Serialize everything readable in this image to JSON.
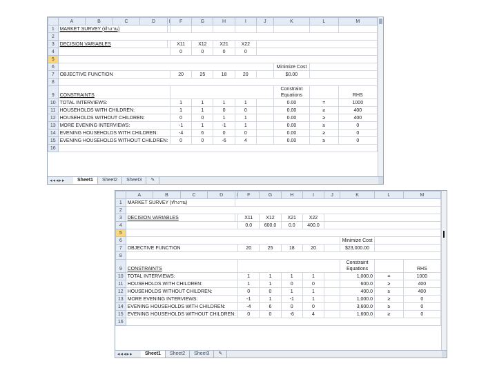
{
  "columns": [
    "A",
    "B",
    "C",
    "D",
    "E",
    "F",
    "G",
    "H",
    "I",
    "J",
    "K",
    "L",
    "M"
  ],
  "sheet_tabs": [
    "Sheet1",
    "Sheet2",
    "Sheet3"
  ],
  "nav_glyphs": "◂◂◂▸▸",
  "spreadsheet1": {
    "title": "MARKET SURVEY (ทำงาน)",
    "decision_label": "DECISION VARIABLES",
    "vars": [
      "X11",
      "X12",
      "X21",
      "X22"
    ],
    "var_values": [
      "0",
      "0",
      "0",
      "0"
    ],
    "minimize_cost_label": "Minimize Cost",
    "objective_label": "OBJECTIVE FUNCTION",
    "objective_coeffs": [
      "20",
      "25",
      "18",
      "20"
    ],
    "cost_value": "$0.00",
    "constraints_label": "CONSTRAINTS",
    "constraint_equations_label": "Constraint Equations",
    "rhs_label": "RHS",
    "constraints": [
      {
        "name": "TOTAL INTERVIEWS:",
        "c": [
          "1",
          "1",
          "1",
          "1"
        ],
        "eq": "0.00",
        "op": "=",
        "rhs": "1000"
      },
      {
        "name": "HOUSEHOLDS WITH CHILDREN:",
        "c": [
          "1",
          "1",
          "0",
          "0"
        ],
        "eq": "0.00",
        "op": "≥",
        "rhs": "400"
      },
      {
        "name": "HOUSEHOLDS WITHOUT CHILDREN:",
        "c": [
          "0",
          "0",
          "1",
          "1"
        ],
        "eq": "0.00",
        "op": "≥",
        "rhs": "400"
      },
      {
        "name": "MORE EVENING INTERVIEWS:",
        "c": [
          "-1",
          "1",
          "-1",
          "1"
        ],
        "eq": "0.00",
        "op": "≥",
        "rhs": "0"
      },
      {
        "name": "EVENING HOUSEHOLDS WITH CHILDREN:",
        "c": [
          "-4",
          "6",
          "0",
          "0"
        ],
        "eq": "0.00",
        "op": "≥",
        "rhs": "0"
      },
      {
        "name": "EVENING HOUSEHOLDS WITHOUT CHILDREN:",
        "c": [
          "0",
          "0",
          "-6",
          "4"
        ],
        "eq": "0.00",
        "op": "≥",
        "rhs": "0"
      }
    ]
  },
  "spreadsheet2": {
    "title": "MARKET SURVEY (ทำงาน)",
    "decision_label": "DECISION VARIABLES",
    "vars": [
      "X11",
      "X12",
      "X21",
      "X22"
    ],
    "var_values": [
      "0.0",
      "600.0",
      "0.0",
      "400.0"
    ],
    "minimize_cost_label": "Minimize Cost",
    "objective_label": "OBJECTIVE FUNCTION",
    "objective_coeffs": [
      "20",
      "25",
      "18",
      "20"
    ],
    "cost_value": "$23,000.00",
    "constraints_label": "CONSTRAINTS",
    "constraint_equations_label": "Constraint Equations",
    "rhs_label": "RHS",
    "constraints": [
      {
        "name": "TOTAL INTERVIEWS:",
        "c": [
          "1",
          "1",
          "1",
          "1"
        ],
        "eq": "1,000.0",
        "op": "=",
        "rhs": "1000"
      },
      {
        "name": "HOUSEHOLDS WITH CHILDREN:",
        "c": [
          "1",
          "1",
          "0",
          "0"
        ],
        "eq": "600.0",
        "op": "≥",
        "rhs": "400"
      },
      {
        "name": "HOUSEHOLDS WITHOUT CHILDREN:",
        "c": [
          "0",
          "0",
          "1",
          "1"
        ],
        "eq": "400.0",
        "op": "≥",
        "rhs": "400"
      },
      {
        "name": "MORE EVENING INTERVIEWS:",
        "c": [
          "-1",
          "1",
          "-1",
          "1"
        ],
        "eq": "1,000.0",
        "op": "≥",
        "rhs": "0"
      },
      {
        "name": "EVENING HOUSEHOLDS WITH CHILDREN:",
        "c": [
          "-4",
          "6",
          "0",
          "0"
        ],
        "eq": "3,600.0",
        "op": "≥",
        "rhs": "0"
      },
      {
        "name": "EVENING HOUSEHOLDS WITHOUT CHILDREN:",
        "c": [
          "0",
          "0",
          "-6",
          "4"
        ],
        "eq": "1,600.0",
        "op": "≥",
        "rhs": "0"
      }
    ]
  }
}
